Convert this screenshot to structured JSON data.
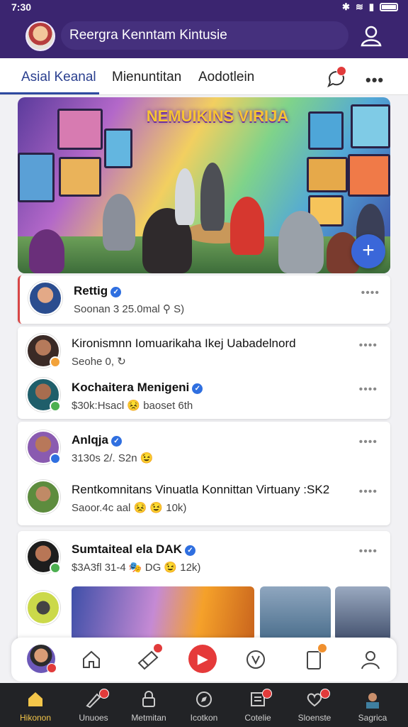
{
  "status_bar": {
    "time": "7:30"
  },
  "header": {
    "title": "Reergra Kenntam Kintusie"
  },
  "tabs": [
    {
      "label": "Asial Keanal"
    },
    {
      "label": "Mienuntitan"
    },
    {
      "label": "Aodotlein"
    }
  ],
  "hero": {
    "title": "NEMUIKINS VIRIJA"
  },
  "posts": [
    {
      "name": "Rettig",
      "meta": "Soonan 3 25.0mal ⚲ S)"
    },
    {
      "name": "Kironismnn Iomuarikaha Ikej Uabadelnord",
      "meta": "Seohe 0, ↻"
    },
    {
      "name": "Kochaitera Menigeni",
      "meta": "$30k:Hsacl 😣 baoset 6th"
    },
    {
      "name": "Anlqja",
      "meta": "3130s 2/. S2n 😉"
    },
    {
      "name": "Rentkomnitans Vinuatla Konnittan Virtuany :SK2",
      "meta": "Saoor.4c aal 😣 😉 10k)"
    },
    {
      "name": "Sumtaiteal ela DAK",
      "meta": "$3A3fl 31-4 🎭 DG 😉 12k)"
    }
  ],
  "notifications": {
    "chat_badge": "",
    "float_bar_badges": [
      "",
      "",
      ""
    ]
  },
  "bottom_nav": [
    {
      "label": "Hikonon",
      "icon": "home-icon"
    },
    {
      "label": "Unuoes",
      "icon": "trophy-icon"
    },
    {
      "label": "Metmitan",
      "icon": "lock-icon"
    },
    {
      "label": "Icotkon",
      "icon": "compass-icon"
    },
    {
      "label": "Cotelie",
      "icon": "list-icon"
    },
    {
      "label": "Sloenste",
      "icon": "heart-icon"
    },
    {
      "label": "Sagrica",
      "icon": "profile-avatar"
    }
  ],
  "colors": {
    "header": "#3b2570",
    "accent": "#2e4aa0",
    "badge": "#e13b3b",
    "nav_active": "#f4c64a"
  }
}
